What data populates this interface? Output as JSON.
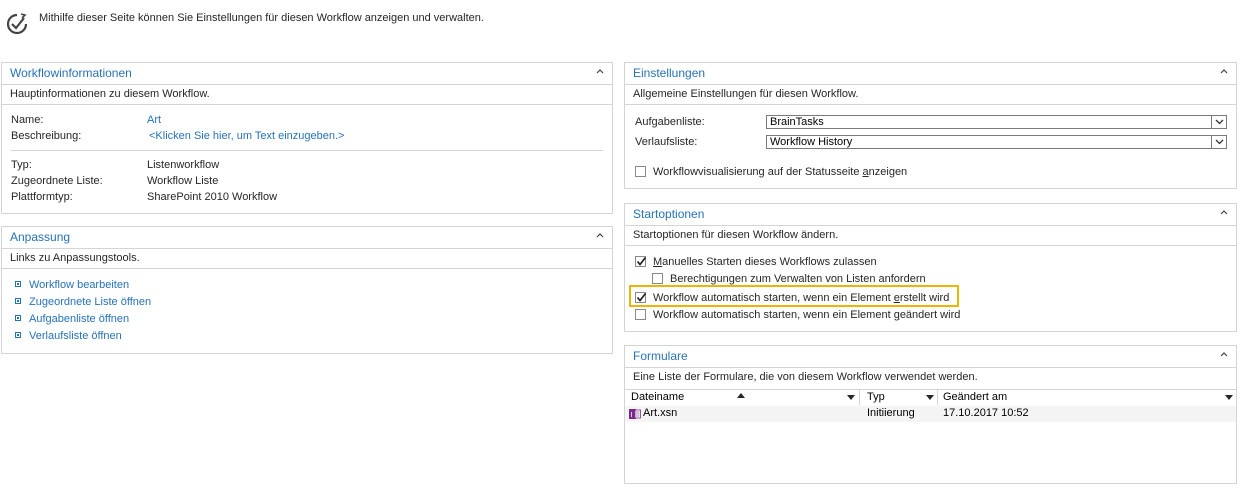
{
  "header": {
    "description": "Mithilfe dieser Seite können Sie Einstellungen für diesen Workflow anzeigen und verwalten.",
    "logo_icon": "workflow-check-icon"
  },
  "workflowinfo": {
    "title": "Workflowinformationen",
    "subtitle": "Hauptinformationen zu diesem Workflow.",
    "name_label": "Name:",
    "name_value": "Art",
    "desc_label": "Beschreibung:",
    "desc_value": "<Klicken Sie hier, um Text einzugeben.>",
    "type_label": "Typ:",
    "type_value": "Listenworkflow",
    "list_label": "Zugeordnete Liste:",
    "list_value": "Workflow Liste",
    "platform_label": "Plattformtyp:",
    "platform_value": "SharePoint 2010 Workflow"
  },
  "anpassung": {
    "title": "Anpassung",
    "subtitle": "Links zu Anpassungstools.",
    "links": [
      "Workflow bearbeiten",
      "Zugeordnete Liste öffnen",
      "Aufgabenliste öffnen",
      "Verlaufsliste öffnen"
    ]
  },
  "einstellungen": {
    "title": "Einstellungen",
    "subtitle": "Allgemeine Einstellungen für diesen Workflow.",
    "task_label": "Aufgabenliste:",
    "task_value": "BrainTasks",
    "history_label": "Verlaufsliste:",
    "history_value": "Workflow History",
    "visual_pre": "Workflowvisualisierung auf der Statusseite ",
    "visual_u": "a",
    "visual_post": "nzeigen",
    "visual_checked": false
  },
  "startoptionen": {
    "title": "Startoptionen",
    "subtitle": "Startoptionen für diesen Workflow ändern.",
    "manual_u": "M",
    "manual_post": "anuelles Starten dieses Workflows zulassen",
    "manual_checked": true,
    "perm_label": "Berechtigungen zum Verwalten von Listen anfordern",
    "perm_checked": false,
    "create_pre": "Workflow automatisch starten, wenn ein Element ",
    "create_u": "e",
    "create_post": "rstellt wird",
    "create_checked": true,
    "change_pre": "Workflow automatisch starten, wenn ein Element ",
    "change_u": "g",
    "change_post": "eändert wird",
    "change_checked": false
  },
  "formulare": {
    "title": "Formulare",
    "subtitle": "Eine Liste der Formulare, die von diesem Workflow verwendet werden.",
    "col_name": "Dateiname",
    "col_type": "Typ",
    "col_changed": "Geändert am",
    "rows": [
      {
        "name": "Art.xsn",
        "type": "Initiierung",
        "changed": "17.10.2017 10:52"
      }
    ]
  },
  "colors": {
    "accent": "#2672b8",
    "highlight": "#f0b400",
    "infopath": "#7b2a8c"
  }
}
